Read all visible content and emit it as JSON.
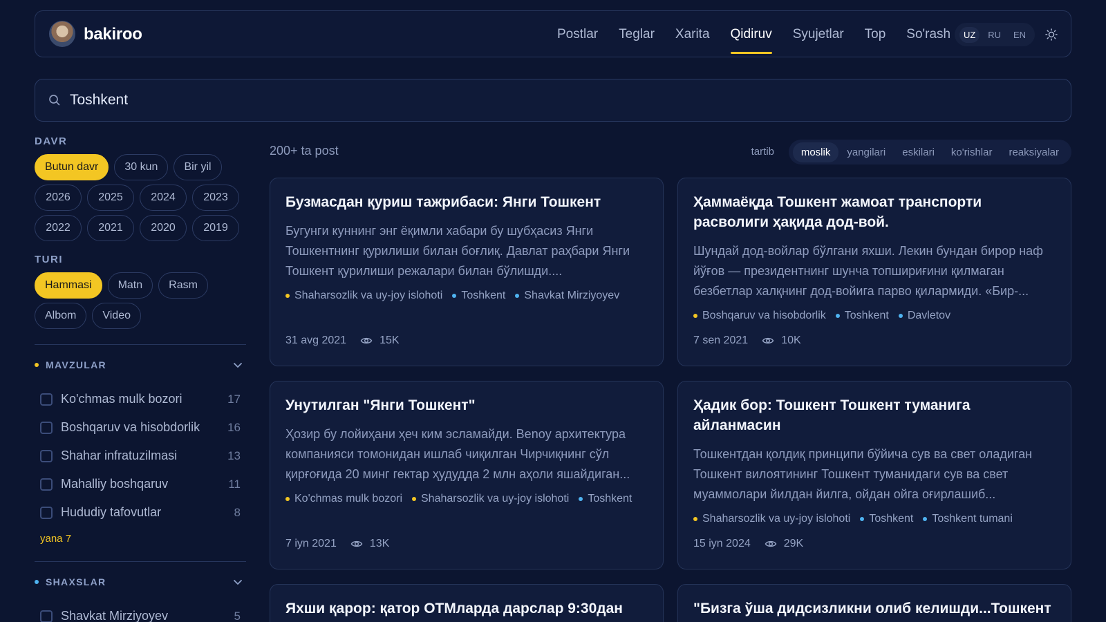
{
  "brand": {
    "name": "bakiroo"
  },
  "nav": [
    {
      "label": "Postlar"
    },
    {
      "label": "Teglar"
    },
    {
      "label": "Xarita"
    },
    {
      "label": "Qidiruv",
      "active": true
    },
    {
      "label": "Syujetlar"
    },
    {
      "label": "Top"
    },
    {
      "label": "So'rash"
    }
  ],
  "languages": [
    "UZ",
    "RU",
    "EN"
  ],
  "search": {
    "value": "Toshkent"
  },
  "filters": {
    "period": {
      "heading": "DAVR",
      "ranges": [
        "Butun davr",
        "30 kun",
        "Bir yil"
      ],
      "years_row1": [
        "2026",
        "2025",
        "2024",
        "2023"
      ],
      "years_row2": [
        "2022",
        "2021",
        "2020",
        "2019"
      ]
    },
    "type": {
      "heading": "TURI",
      "row1": [
        "Hammasi",
        "Matn",
        "Rasm"
      ],
      "row2": [
        "Albom",
        "Video"
      ]
    },
    "topics": {
      "heading": "MAVZULAR",
      "items": [
        {
          "label": "Ko'chmas mulk bozori",
          "count": "17"
        },
        {
          "label": "Boshqaruv va hisobdorlik",
          "count": "16"
        },
        {
          "label": "Shahar infratuzilmasi",
          "count": "13"
        },
        {
          "label": "Mahalliy boshqaruv",
          "count": "11"
        },
        {
          "label": "Hududiy tafovutlar",
          "count": "8"
        }
      ],
      "more": "yana 7"
    },
    "persons": {
      "heading": "SHAXSLAR",
      "items": [
        {
          "label": "Shavkat Mirziyoyev",
          "count": "5"
        }
      ]
    }
  },
  "results": {
    "count": "200+ ta post",
    "sort_label": "tartib",
    "sort_options": [
      "moslik",
      "yangilari",
      "eskilari",
      "ko'rishlar",
      "reaksiyalar"
    ]
  },
  "posts": [
    {
      "title": "Бузмасдан қуриш тажрибаси: Янги Тошкент",
      "excerpt": "Бугунги куннинг энг ёқимли хабари бу шубҳасиз Янги Тошкентнинг қурилиши билан боғлиқ. Давлат раҳбари Янги Тошкент қурилиши режалари билан бўлишди....",
      "tags": [
        {
          "label": "Shaharsozlik va uy-joy islohoti",
          "color": "#f3c623"
        },
        {
          "label": "Toshkent",
          "color": "#4fb3f0"
        },
        {
          "label": "Shavkat Mirziyoyev",
          "color": "#4fb3f0"
        }
      ],
      "date": "31 avg 2021",
      "views": "15K"
    },
    {
      "title": "Ҳаммаёқда Тошкент жамоат транспорти расволиги ҳақида дод-вой.",
      "excerpt": "Шундай дод-войлар бўлгани яхши. Лекин бундан бирор наф йўғов — президентнинг шунча топшириғини қилмаган безбетлар халқнинг дод-войига парво қилармиди. «Бир-...",
      "tags": [
        {
          "label": "Boshqaruv va hisobdorlik",
          "color": "#f3c623"
        },
        {
          "label": "Toshkent",
          "color": "#4fb3f0"
        },
        {
          "label": "Davletov",
          "color": "#4fb3f0"
        }
      ],
      "date": "7 sen 2021",
      "views": "10K"
    },
    {
      "title": "Унутилган \"Янги Тошкент\"",
      "excerpt": "Ҳозир бу лойиҳани ҳеч ким эсламайди. Benoy архитектура компанияси томонидан ишлаб чиқилган Чирчиқнинг сўл қирғоғида 20 минг гектар ҳудудда 2 млн аҳоли яшайдиган...",
      "tags": [
        {
          "label": "Ko'chmas mulk bozori",
          "color": "#f3c623"
        },
        {
          "label": "Shaharsozlik va uy-joy islohoti",
          "color": "#f3c623"
        },
        {
          "label": "Toshkent",
          "color": "#4fb3f0"
        }
      ],
      "date": "7 iyn 2021",
      "views": "13K"
    },
    {
      "title": "Ҳадик бор: Тошкент Тошкент туманига айланмасин",
      "excerpt": "Тошкентдан қолдиқ принципи бўйича сув ва свет оладиган Тошкент вилоятининг Тошкент туманидаги сув ва свет муаммолари йилдан йилга, ойдан ойга оғирлашиб...",
      "tags": [
        {
          "label": "Shaharsozlik va uy-joy islohoti",
          "color": "#f3c623"
        },
        {
          "label": "Toshkent",
          "color": "#4fb3f0"
        },
        {
          "label": "Toshkent tumani",
          "color": "#4fb3f0"
        }
      ],
      "date": "15 iyn 2024",
      "views": "29K"
    },
    {
      "title": "Яхши қарор: қатор ОТМларда дарслар 9:30дан"
    },
    {
      "title": "\"Бизга ўша дидсизликни олиб келишди...Тошкент"
    }
  ]
}
